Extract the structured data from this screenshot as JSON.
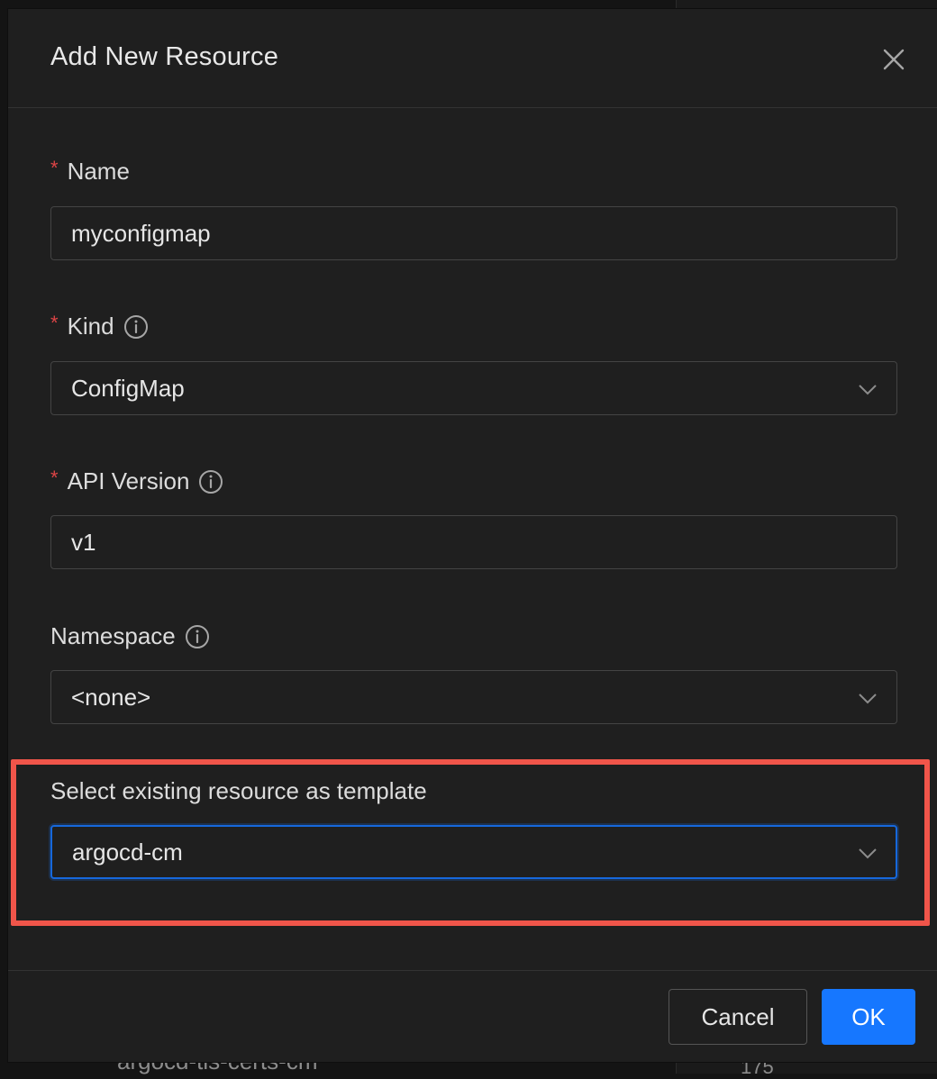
{
  "dialog": {
    "title": "Add New Resource",
    "close_label": "Close"
  },
  "fields": {
    "name": {
      "label": "Name",
      "required": true,
      "value": "myconfigmap"
    },
    "kind": {
      "label": "Kind",
      "required": true,
      "value": "ConfigMap",
      "has_info_icon": true
    },
    "api_version": {
      "label": "API Version",
      "required": true,
      "value": "v1",
      "has_info_icon": true
    },
    "namespace": {
      "label": "Namespace",
      "required": false,
      "value": "<none>",
      "has_info_icon": true
    },
    "template": {
      "label": "Select existing resource as template",
      "value": "argocd-cm",
      "focused": true
    }
  },
  "required_marker": "*",
  "footer": {
    "cancel_label": "Cancel",
    "ok_label": "OK"
  },
  "background": {
    "partial_text_bottom": "argocd-tls-certs-cm",
    "partial_number_bottom": "175"
  },
  "colors": {
    "accent": "#1677ff",
    "required": "#dc4446",
    "highlight": "#f0554a",
    "modal_bg": "#1f1f1f"
  },
  "icons": {
    "close": "close-icon",
    "info": "info-circle-icon",
    "chevron": "chevron-down-icon"
  }
}
